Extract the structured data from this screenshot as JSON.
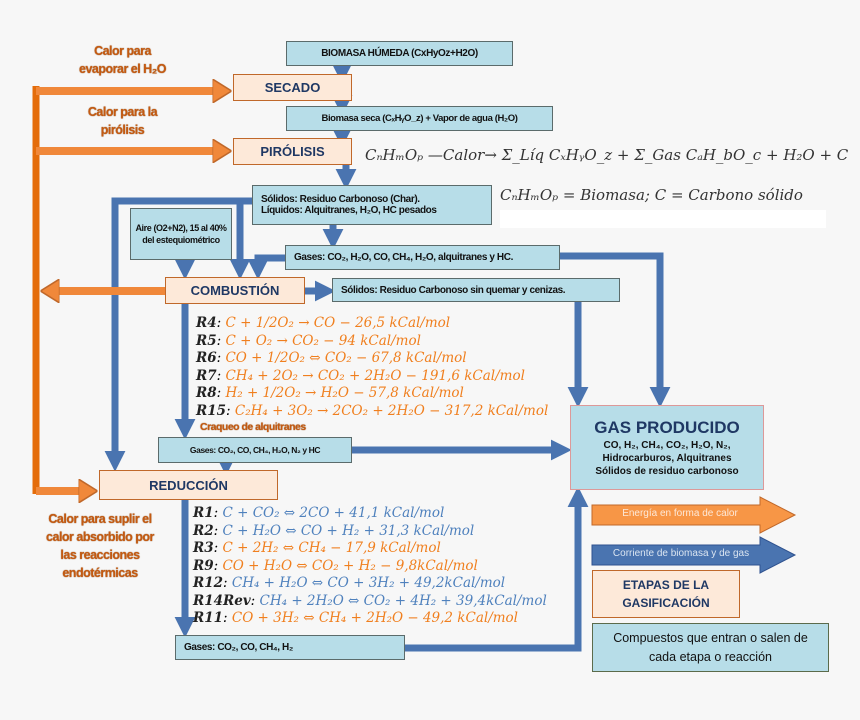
{
  "colors": {
    "heat_arrow": "#f0883a",
    "flow_arrow": "#4a74b0",
    "stage_fill": "#fde9d9",
    "compound_fill": "#b7dde8",
    "endothermic_eq": "#4f81bd",
    "exothermic_eq": "#f07f1e"
  },
  "heat_labels": {
    "evaporate": [
      "Calor para",
      "evaporar el H₂O"
    ],
    "pyrolysis": [
      "Calor para la",
      "pirólisis"
    ],
    "endothermic": [
      "Calor para suplir el",
      "calor absorbido por",
      "las reacciones",
      "endotérmicas"
    ]
  },
  "compounds": {
    "wet_biomass": "BIOMASA HÚMEDA (CxHyOz+H2O)",
    "dry_biomass": "Biomasa seca (CₓHᵧO_z) + Vapor de agua (H₂O)",
    "solids_liquids": [
      "Sólidos: Residuo Carbonoso (Char).",
      "Líquidos: Alquitranes, H₂O, HC pesados"
    ],
    "air": "Aire (O2+N2), 15 al 40% del estequiométrico",
    "pyro_gases": "Gases: CO₂, H₂O, CO, CH₄, H₂O, alquitranes y HC.",
    "combustion_solids": "Sólidos: Residuo Carbonoso sin quemar y cenizas.",
    "combustion_gases": "Gases: CO₂, CO, CH₄, H₂O, N₂  y HC",
    "reduction_gases": "Gases: CO₂, CO, CH₄, H₂"
  },
  "stages": {
    "drying": "SECADO",
    "pyrolysis": "PIRÓLISIS",
    "combustion": "COMBUSTIÓN",
    "reduction": "REDUCCIÓN"
  },
  "pyrolysis_equation": {
    "line1": "CₙHₘOₚ —Calor→ Σ_Líq CₓHᵧO_z + Σ_Gas CₐH_bO_c + H₂O + C",
    "line2": "CₙHₘOₚ = Biomasa; C = Carbono sólido"
  },
  "combustion_reactions": [
    {
      "id": "R4",
      "eq": "C + 1/2O₂ → CO − 26,5 kCal/mol"
    },
    {
      "id": "R5",
      "eq": "C + O₂ → CO₂ − 94 kCal/mol"
    },
    {
      "id": "R6",
      "eq": "CO + 1/2O₂ ⇔ CO₂ − 67,8 kCal/mol"
    },
    {
      "id": "R7",
      "eq": "CH₄ + 2O₂ → CO₂ + 2H₂O − 191,6 kCal/mol"
    },
    {
      "id": "R8",
      "eq": "H₂ + 1/2O₂ → H₂O − 57,8 kCal/mol"
    },
    {
      "id": "R15",
      "eq": "C₂H₄ + 3O₂ → 2CO₂ + 2H₂O − 317,2 kCal/mol"
    }
  ],
  "tar_cracking": "Craqueo de alquitranes",
  "reduction_reactions": [
    {
      "id": "R1",
      "eq": "C + CO₂ ⇔ 2CO + 41,1 kCal/mol",
      "type": "endo"
    },
    {
      "id": "R2",
      "eq": "C + H₂O ⇔ CO + H₂ + 31,3 kCal/mol",
      "type": "endo"
    },
    {
      "id": "R3",
      "eq": "C + 2H₂ ⇔ CH₄ − 17,9 kCal/mol",
      "type": "exo"
    },
    {
      "id": "R9",
      "eq": "CO + H₂O ⇔ CO₂ + H₂ − 9,8kCal/mol",
      "type": "exo"
    },
    {
      "id": "R12",
      "eq": "CH₄ + H₂O ⇔ CO + 3H₂ + 49,2kCal/mol",
      "type": "endo"
    },
    {
      "id": "R14Rev",
      "eq": "CH₄ + 2H₂O ⇔ CO₂ + 4H₂ + 39,4kCal/mol",
      "type": "endo"
    },
    {
      "id": "R11",
      "eq": "CO + 3H₂ ⇔ CH₄ + 2H₂O − 49,2 kCal/mol",
      "type": "exo"
    }
  ],
  "product": {
    "title": "GAS PRODUCIDO",
    "lines": [
      "CO, H₂, CH₄, CO₂, H₂O, N₂,",
      "Hidrocarburos, Alquitranes",
      "Sólidos de residuo carbonoso"
    ]
  },
  "legend": {
    "heat": "Energía en forma de calor",
    "flow": "Corriente de biomasa y de gas",
    "stages": "ETAPAS DE LA GASIFICACIÓN",
    "compounds": "Compuestos que entran o salen de cada etapa o reacción"
  }
}
